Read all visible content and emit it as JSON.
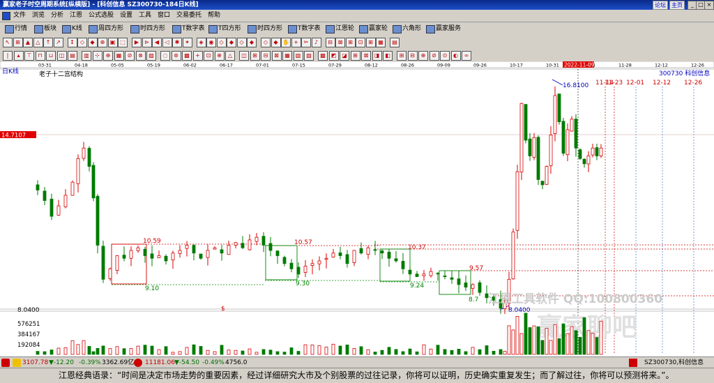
{
  "titlebar": {
    "title": "赢家老子时空周期系统[纵横版] - [科创信息 SZ300730-184日K线]",
    "right_links": [
      "论坛",
      "主页"
    ],
    "win_buttons": [
      "_",
      "□",
      "×"
    ]
  },
  "menu": [
    "文件",
    "浏览",
    "分析",
    "江恩",
    "公式选股",
    "设置",
    "工具",
    "窗口",
    "交易委托",
    "帮助"
  ],
  "toolbar1": [
    "行情",
    "板块",
    "K线",
    "周四方形",
    "时四方形",
    "T数字表",
    "T四方形",
    "时四方形",
    "T数字表",
    "江恩轮",
    "赢家轮",
    "六角形",
    "赢家服务"
  ],
  "chart": {
    "period_label": "日K线",
    "study_label": "老子十二宫结构",
    "stock_code_name": "300730 科创信息",
    "price_tag": "14.7107",
    "low_value_label": "8.0400",
    "highlight_date": "2022-11-09",
    "dates_top": [
      "03-31",
      "04-18",
      "05-05",
      "05-19",
      "06-02",
      "06-17",
      "07-01",
      "07-15",
      "07-29",
      "08-12",
      "08-26",
      "09-09",
      "09-26",
      "10-17",
      "10-31",
      "11-14",
      "11-28",
      "12-12",
      "12-26"
    ],
    "future_dates": [
      "11-14",
      "11-23",
      "12-01",
      "12-12",
      "12-26"
    ],
    "high_label": "16.8100",
    "box_labels": [
      {
        "top": "10.59",
        "bottom": "9.10"
      },
      {
        "top": "10.57",
        "bottom": "9.30"
      },
      {
        "top": "10.37",
        "bottom": "9.24"
      },
      {
        "top": "9.57",
        "bottom": "8.7"
      }
    ],
    "volume_ticks": [
      "576251",
      "384167",
      "192084"
    ],
    "watermark": "江恩工具软件 QQ:100800360",
    "watermark2": "赢家聊吧"
  },
  "status": {
    "sh_index": "3107.78",
    "sh_change": "▼-12.20",
    "sh_pct": "-0.39%",
    "sh_amount": "3362.69亿",
    "sz_index": "11181.06",
    "sz_change": "▼-54.50",
    "sz_pct": "-0.49%",
    "sz_amount": "4756.0",
    "current_stock": "SZ300730,科创信息"
  },
  "quote": "江恩经典语录：“时间是决定市场走势的重要因素，经过详细研究大市及个别股票的过往记录，你将可以证明，历史确实重复发生；而了解过往，你将可以预测将来。”。",
  "colors": {
    "up": "#d80000",
    "down": "#007a00",
    "hl": "#c80000"
  }
}
